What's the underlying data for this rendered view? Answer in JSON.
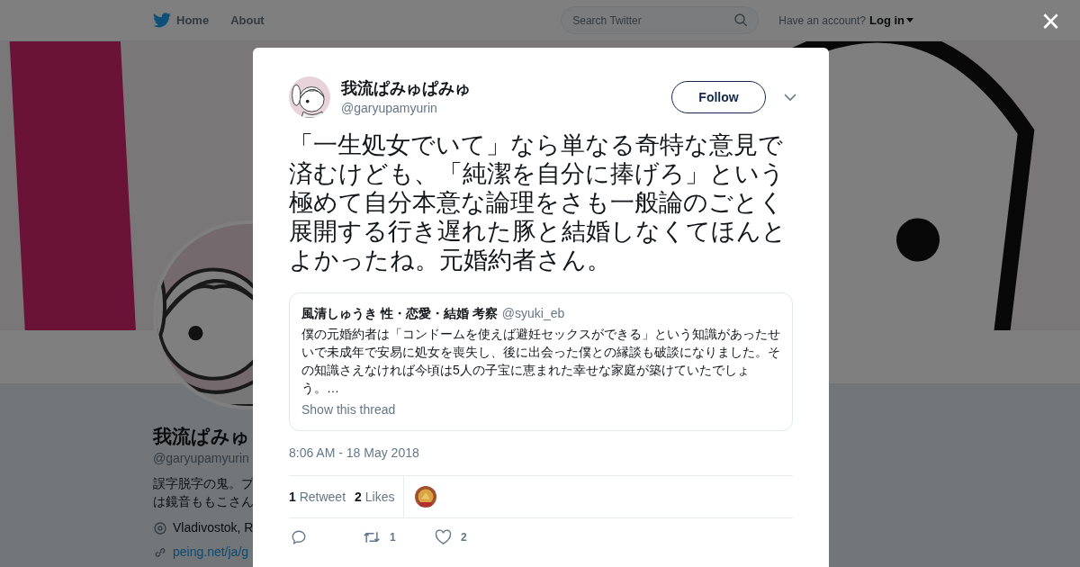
{
  "header": {
    "nav": [
      {
        "label": "Home",
        "kind": "home"
      },
      {
        "label": "About",
        "kind": "plain"
      }
    ],
    "search": {
      "placeholder": "Search Twitter"
    },
    "account_prompt": "Have an account?",
    "login": "Log in"
  },
  "profile": {
    "name": "我流ぱみゅ",
    "handle": "@garyupamyurin",
    "bio": [
      "誤字脱字の鬼。プ",
      "は鏡音ももこさん"
    ],
    "location": "Vladivostok, R",
    "link": "peing.net/ja/g"
  },
  "close": "×",
  "tweet": {
    "author": {
      "name": "我流ぱみゅぱみゅ",
      "handle": "@garyupamyurin"
    },
    "follow": "Follow",
    "text": "「一生処女でいて」なら単なる奇特な意見で済むけども、「純潔を自分に捧げろ」という極めて自分本意な論理をさも一般論のごとく展開する行き遅れた豚と結婚しなくてほんとよかったね。元婚約者さん。",
    "quote": {
      "name": "風清しゅうき 性・恋愛・結婚 考察",
      "handle": "@syuki_eb",
      "text": "僕の元婚約者は「コンドームを使えば避妊セックスができる」という知識があったせいで未成年で安易に処女を喪失し、後に出会った僕との縁談も破談になりました。その知識さえなければ今頃は5人の子宝に恵まれた幸せな家庭が築けていたでしょう。…",
      "thread_link": "Show this thread"
    },
    "timestamp": "8:06 AM - 18 May 2018",
    "stats": [
      {
        "count": "1",
        "label": "Retweet"
      },
      {
        "count": "2",
        "label": "Likes"
      }
    ],
    "actions": [
      {
        "kind": "reply"
      },
      {
        "kind": "retweet",
        "count": "1"
      },
      {
        "kind": "like",
        "count": "2"
      }
    ]
  }
}
